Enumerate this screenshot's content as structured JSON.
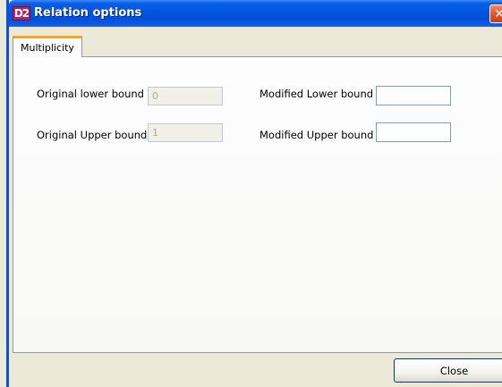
{
  "window": {
    "title": "Relation options",
    "badge": "D2",
    "close_glyph": "✕"
  },
  "tabs": [
    {
      "label": "Multiplicity",
      "active": true
    }
  ],
  "form": {
    "original_lower": {
      "label": "Original lower bound",
      "value": "0",
      "disabled": true
    },
    "original_upper": {
      "label": "Original Upper bound",
      "value": "1",
      "disabled": true
    },
    "modified_lower": {
      "label": "Modified Lower bound",
      "value": ""
    },
    "modified_upper": {
      "label": "Modified Upper bound",
      "value": ""
    }
  },
  "buttons": {
    "close_label": "Close"
  },
  "colors": {
    "titlebar": "#0355e0",
    "tab_accent": "#f6a71a",
    "close_red": "#e2572a",
    "face": "#ece9d8"
  },
  "icons": {
    "window_close": "close-icon",
    "app": "app-badge-icon"
  }
}
